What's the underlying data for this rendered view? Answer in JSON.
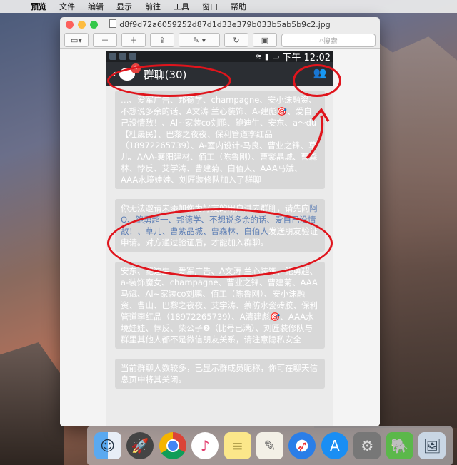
{
  "menubar": {
    "apple": "",
    "items": [
      "预览",
      "文件",
      "编辑",
      "显示",
      "前往",
      "工具",
      "窗口",
      "帮助"
    ]
  },
  "window": {
    "title": "d8f9d72a6059252d87d1d33e379b033b5ab5b9c2.jpg",
    "search_placeholder": "搜索"
  },
  "phone": {
    "status_time": "下午 12:02",
    "nav_back": "‹",
    "nav_title": "群聊(30)",
    "badge": "4",
    "msg1": "…、爱军广告、邦德学、champagne、安小沫融资、不想说多余的话、A文涛 兰心装饰、A-建彪🎯、爱自己没情敌！、Al~家装co刘鹏、鲍迪生、安东、a～du【杜晟民】、巴黎之夜夜、保利管道李红品（18972265739）、A-室内设计-马良、曹业之锋、草儿、AAA-襄阳建材、佰工（陈鲁刚）、曹紫晶城、曹森林、悖反、艾学涛、曹建菊、白佰人、AAA马斌、AAA水境娃娃、刘匠装修队加入了群聊",
    "msg2_pre": "你无法邀请未添加你为好友的用户进去群聊，请先向",
    "msg2_names": "阿Q、鲍勇超一、邦德学、不想说多余的话、爱自己没情敌！、草儿、曹紫晶城、曹森林、白佰人",
    "msg2_post": "发送朋友验证申请。对方通过验证后，才能加入群聊。",
    "msg3": "安东、鲍迪生、爱军广告、A文涛 兰心装饰、鲍勇超、a-装饰魔女、champagne、曹业之锋、曹建菊、AAA马斌、Al~家装co刘鹏、佰工（陈鲁刚）、安小沫融资、曹山、巴黎之夜夜、艾学涛、蔡防水瓷砖胶、保利管道李红品（18972265739）、A清建彪🎯、AAA水境娃娃、悖反、柴公子❷（比号已满）、刘匠装修队与群里其他人都不是微信朋友关系，请注意隐私安全",
    "msg4": "当前群聊人数较多，已显示群成员昵称，你可在聊天信息页中将其关闭。"
  },
  "dock": {
    "icons": [
      "finder-icon",
      "launchpad-icon",
      "chrome-icon",
      "itunes-icon",
      "notes-icon",
      "textedit-icon",
      "safari-icon",
      "appstore-icon",
      "preferences-icon",
      "evernote-icon",
      "preview-icon"
    ]
  },
  "colors": {
    "annotation": "#e0141c",
    "accent": "#5e7fb5"
  }
}
